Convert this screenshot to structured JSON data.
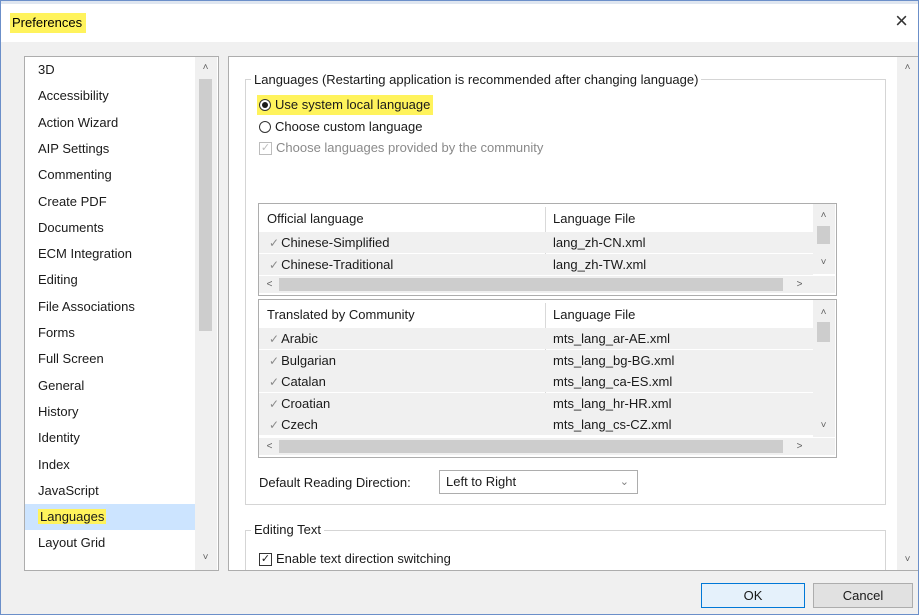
{
  "window": {
    "title": "Preferences",
    "close_glyph": "×"
  },
  "sidebar": {
    "items": [
      {
        "label": "3D"
      },
      {
        "label": "Accessibility"
      },
      {
        "label": "Action Wizard"
      },
      {
        "label": "AIP Settings"
      },
      {
        "label": "Commenting"
      },
      {
        "label": "Create PDF"
      },
      {
        "label": "Documents"
      },
      {
        "label": "ECM Integration"
      },
      {
        "label": "Editing"
      },
      {
        "label": "File Associations"
      },
      {
        "label": "Forms"
      },
      {
        "label": "Full Screen"
      },
      {
        "label": "General"
      },
      {
        "label": "History"
      },
      {
        "label": "Identity"
      },
      {
        "label": "Index"
      },
      {
        "label": "JavaScript"
      },
      {
        "label": "Languages"
      },
      {
        "label": "Layout Grid"
      }
    ],
    "selected": "Languages"
  },
  "languages": {
    "group_title": "Languages (Restarting application is recommended after changing language)",
    "option_system": "Use system local language",
    "option_custom": "Choose custom language",
    "option_community": "Choose languages provided by the community",
    "selected_option": "Use system local language"
  },
  "official_table": {
    "col1": "Official language",
    "col2": "Language File",
    "rows": [
      {
        "name": "Chinese-Simplified",
        "file": "lang_zh-CN.xml"
      },
      {
        "name": "Chinese-Traditional",
        "file": "lang_zh-TW.xml"
      }
    ]
  },
  "community_table": {
    "col1": "Translated by Community",
    "col2": "Language File",
    "rows": [
      {
        "name": "Arabic",
        "file": "mts_lang_ar-AE.xml"
      },
      {
        "name": "Bulgarian",
        "file": "mts_lang_bg-BG.xml"
      },
      {
        "name": "Catalan",
        "file": "mts_lang_ca-ES.xml"
      },
      {
        "name": "Croatian",
        "file": "mts_lang_hr-HR.xml"
      },
      {
        "name": "Czech",
        "file": "mts_lang_cs-CZ.xml"
      }
    ]
  },
  "reading_direction": {
    "label": "Default Reading Direction:",
    "value": "Left to Right"
  },
  "editing_text": {
    "group_title": "Editing Text",
    "checkbox_label": "Enable text direction switching",
    "checked": true
  },
  "buttons": {
    "ok": "OK",
    "cancel": "Cancel"
  },
  "colors": {
    "highlight": "#fff35c",
    "selection": "#cce4ff",
    "default_button_border": "#0078d7"
  },
  "icons": {
    "check": "✓",
    "row_check": "✓",
    "up": "˄",
    "down": "˅",
    "left": "<",
    "right": ">",
    "chevron": "⌄"
  }
}
